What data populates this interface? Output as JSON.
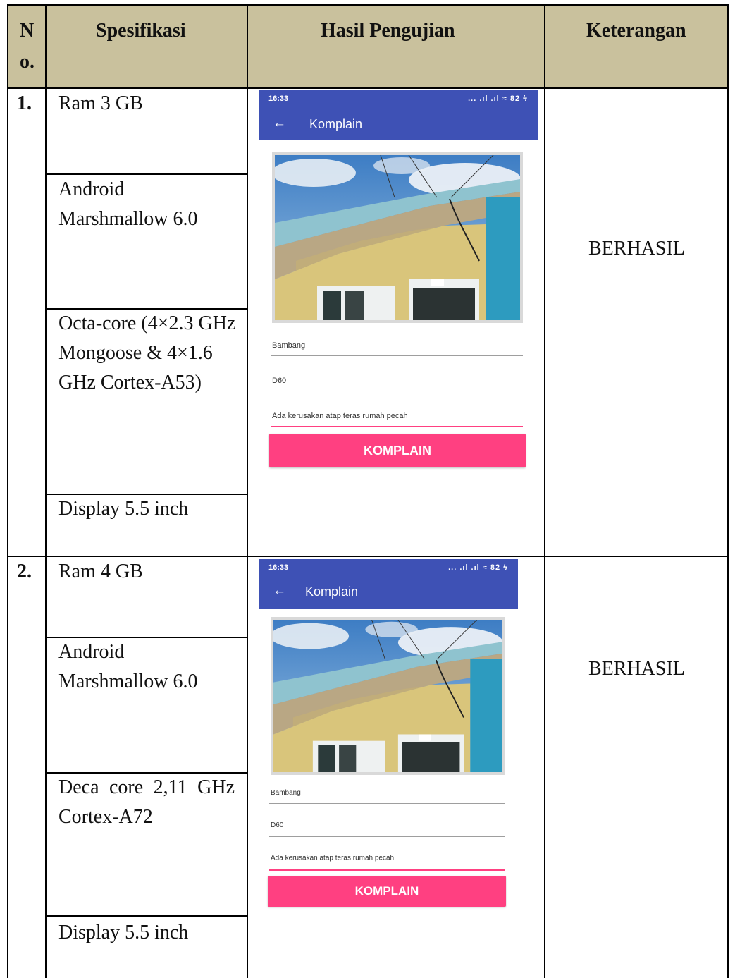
{
  "header": {
    "no_1": "N",
    "no_2": "o.",
    "spesifikasi": "Spesifikasi",
    "hasil": "Hasil Pengujian",
    "keterangan": "Keterangan"
  },
  "rows": [
    {
      "no": "1.",
      "specs": [
        "Ram 3 GB",
        "Android Marshmallow 6.0",
        "Octa-core (4×2.3 GHz Mongoose & 4×1.6 GHz Cortex-A53)",
        "Display 5.5 inch"
      ],
      "keterangan": "BERHASIL",
      "screenshot": {
        "time": "16:33",
        "status_icons": "... .ıl .ıl ≈ 82 ϟ",
        "title": "Komplain",
        "field1": "Bambang",
        "field2": "D60",
        "field3": "Ada kerusakan atap teras rumah pecah",
        "button": "KOMPLAIN"
      }
    },
    {
      "no": "2.",
      "specs": [
        "Ram 4 GB",
        "Android Marshmallow 6.0",
        "Deca core 2,11 GHz Cortex-A72",
        "Display 5.5 inch"
      ],
      "keterangan": "BERHASIL",
      "screenshot": {
        "time": "16:33",
        "status_icons": "... .ıl .ıl ≈ 82 ϟ",
        "title": "Komplain",
        "field1": "Bambang",
        "field2": "D60",
        "field3": "Ada kerusakan atap teras rumah pecah",
        "button": "KOMPLAIN"
      }
    }
  ],
  "colors": {
    "header_bg": "#c9c19d",
    "app_bar": "#3e51b5",
    "accent": "#ff4081"
  }
}
